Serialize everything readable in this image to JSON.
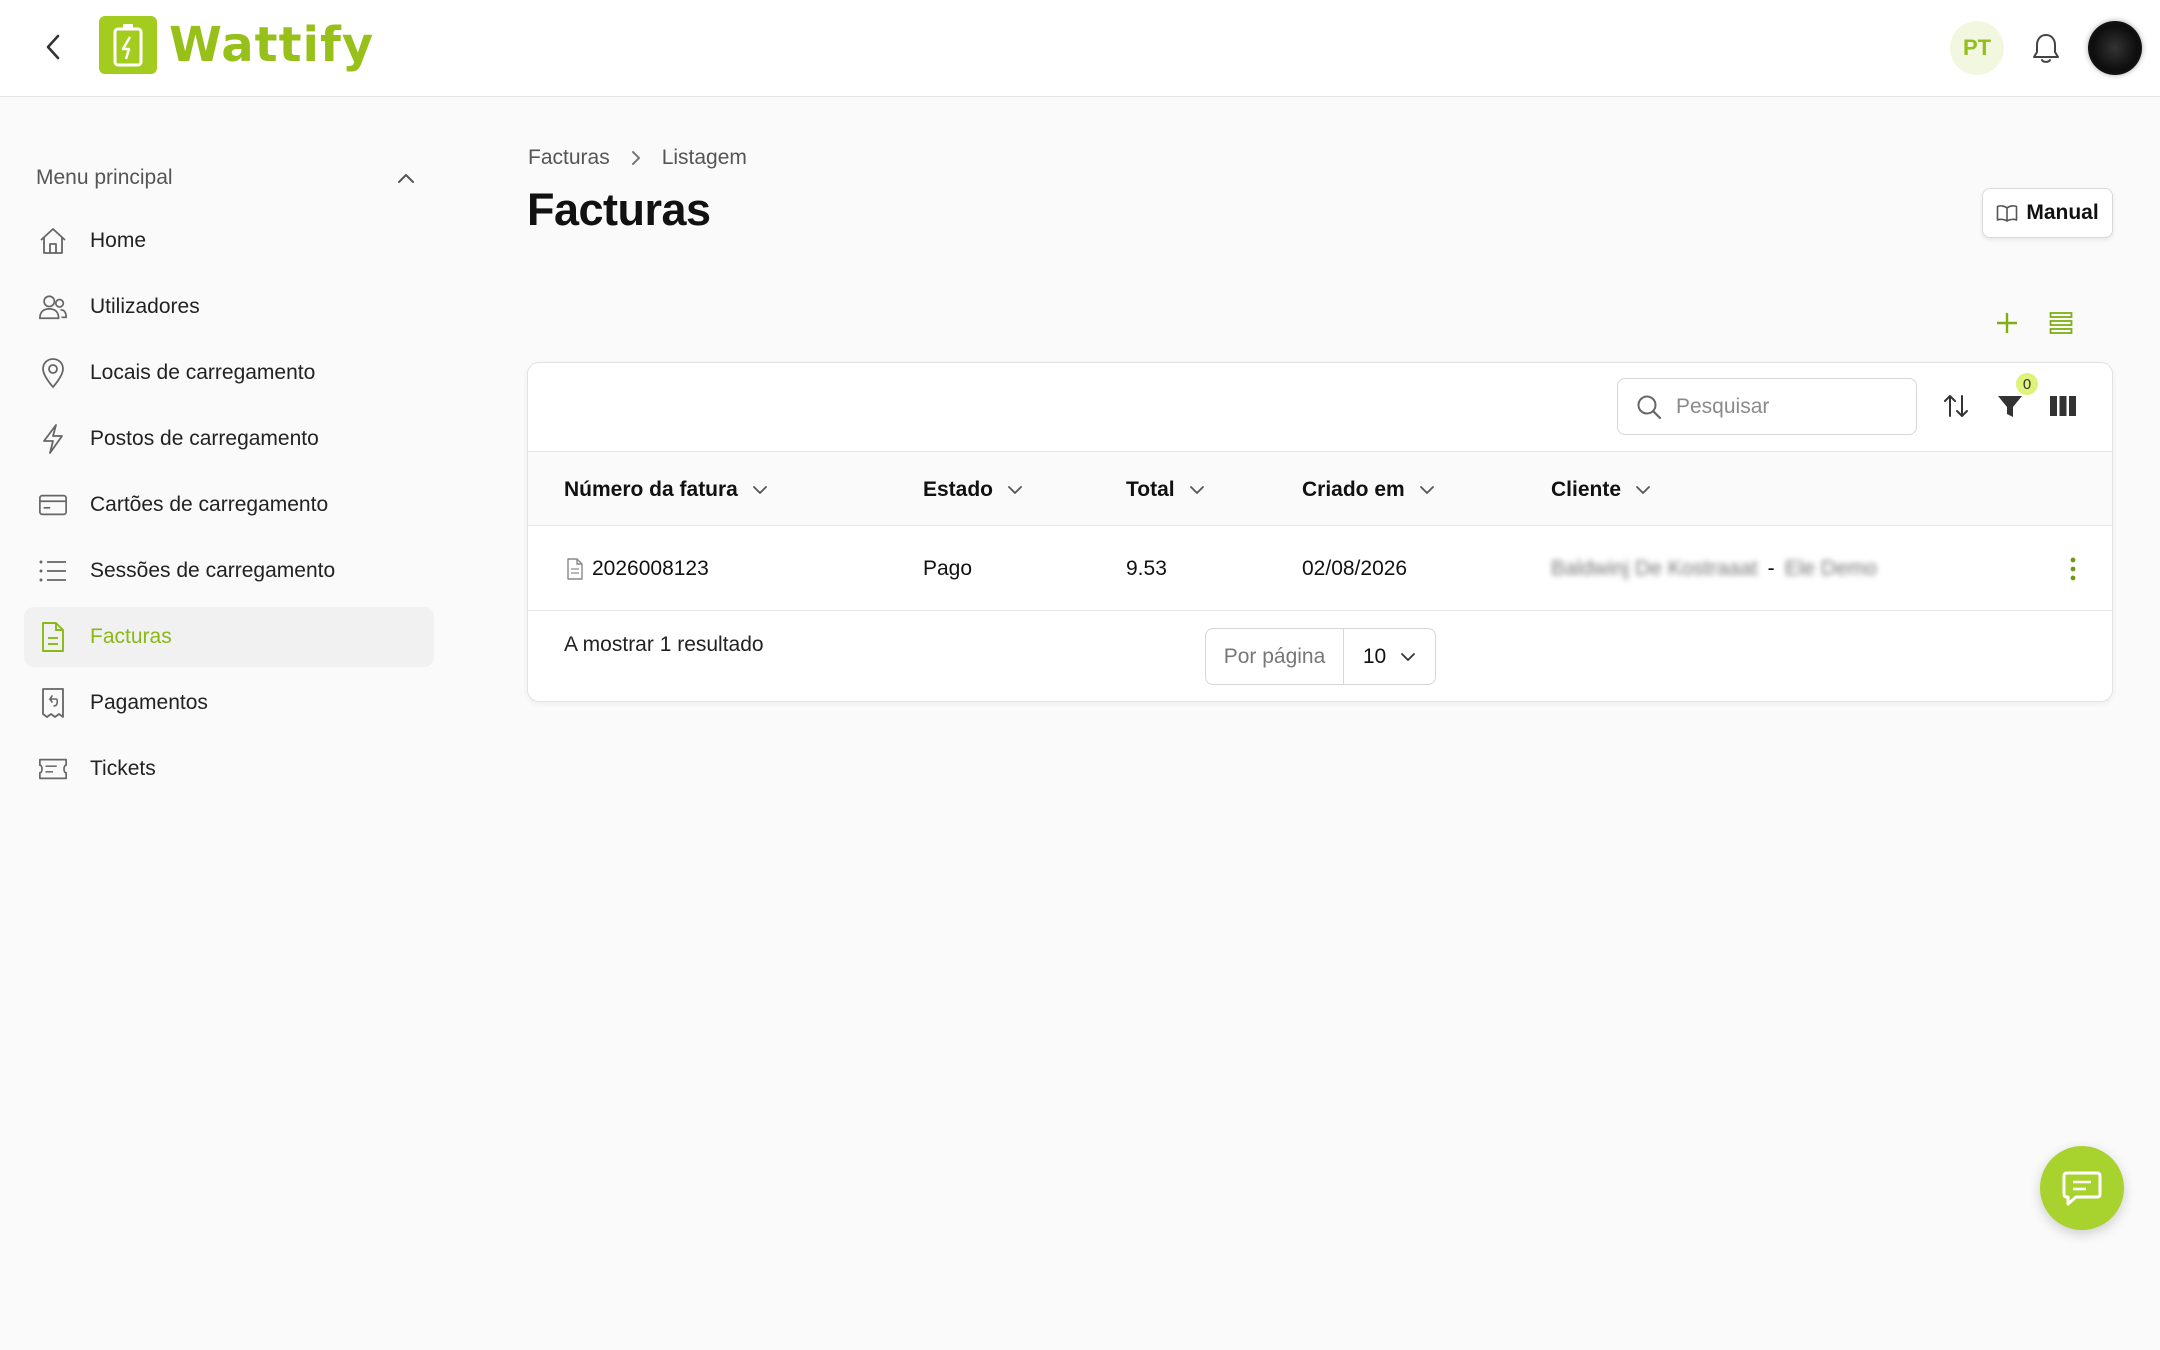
{
  "header": {
    "logo_text": "Wattify",
    "lang_badge": "PT",
    "accent_color": "#9ac71c"
  },
  "sidebar": {
    "heading": "Menu principal",
    "items": [
      {
        "label": "Home",
        "icon": "home-icon"
      },
      {
        "label": "Utilizadores",
        "icon": "users-icon"
      },
      {
        "label": "Locais de carregamento",
        "icon": "map-pin-icon"
      },
      {
        "label": "Postos de carregamento",
        "icon": "bolt-icon"
      },
      {
        "label": "Cartões de carregamento",
        "icon": "credit-card-icon"
      },
      {
        "label": "Sessões de carregamento",
        "icon": "list-icon"
      },
      {
        "label": "Facturas",
        "icon": "document-icon",
        "active": true
      },
      {
        "label": "Pagamentos",
        "icon": "receipt-icon"
      },
      {
        "label": "Tickets",
        "icon": "ticket-icon"
      }
    ]
  },
  "breadcrumb": {
    "root": "Facturas",
    "current": "Listagem"
  },
  "page": {
    "title": "Facturas",
    "manual_label": "Manual"
  },
  "toolbar": {
    "search_placeholder": "Pesquisar",
    "filter_count": "0"
  },
  "table": {
    "columns": [
      "Número da fatura",
      "Estado",
      "Total",
      "Criado em",
      "Cliente"
    ],
    "rows": [
      {
        "invoice_number": "2026008123",
        "status": "Pago",
        "total": "9.53",
        "created_at": "02/08/2026",
        "client_name": "Baldwinj De Kostraaat",
        "client_sep": "-",
        "client_org": "Ele Demo"
      }
    ]
  },
  "footer": {
    "results_text": "A mostrar 1 resultado",
    "per_page_label": "Por página",
    "per_page_value": "10"
  }
}
